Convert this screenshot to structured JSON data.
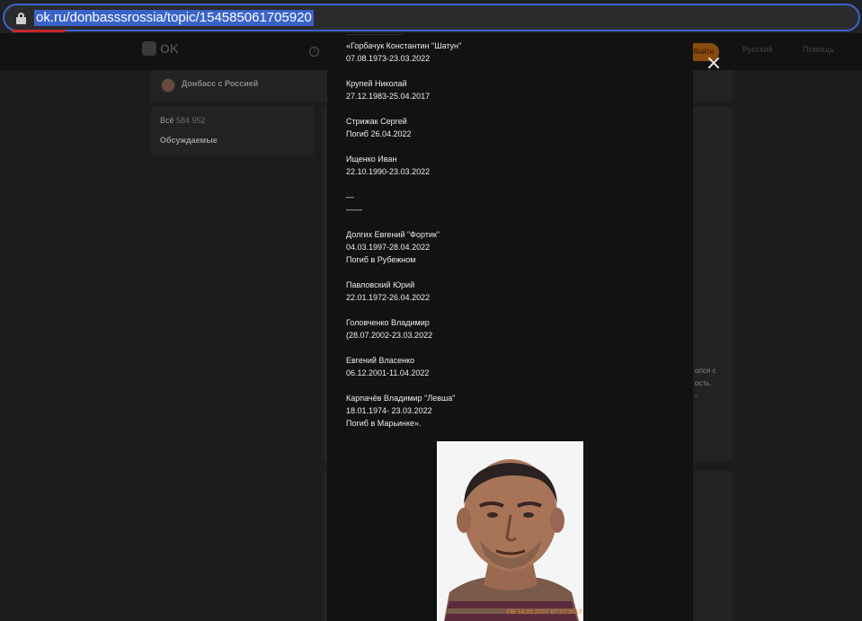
{
  "browser": {
    "url": "ok.ru/donbasssrossia/topic/154585061705920"
  },
  "background": {
    "logo_text": "OK",
    "login_label": "Войти",
    "lang_label": "Русский",
    "help_label": "Помощь",
    "group_name": "Донбасс с Россией",
    "all_label": "Всё",
    "all_count": "584 952",
    "discussed_label": "Обсуждаемые",
    "right_snippet_1": "олся с",
    "right_snippet_2": "ость.",
    "right_snippet_3": "-"
  },
  "post": {
    "text": "———————\n«Горбачук Константин \"Шатун\"\n07.08.1973-23.03.2022\n\nКрупей Николай\n27.12.1983-25.04.2017\n\nСтрижак Сергей\nПогиб 26.04.2022\n\nИщенко Иван\n22.10.1990-23.03.2022\n\n—\n——\n\nДолгих Евгений \"Фортик\"\n04.03.1997-28.04.2022\nПогиб в Рубежном\n\nПавловский Юрий\n22.01.1972-26.04.2022\n\nГоловченко Владимир\n(28.07.2002-23.03.2022\n\nЕвгений Власенко\n06.12.2001-11.04.2022\n\nКарпачёв Владимир \"Левша\"\n18.01.1974- 23.03.2022\nПогиб в Марьинке».",
    "photo_watermark": "ПВ 14.01.2017 07:27:2017"
  },
  "colors": {
    "selection": "#3a63c9",
    "accent_orange": "#e0822d"
  },
  "icons": [
    "lock-icon",
    "close-icon"
  ]
}
